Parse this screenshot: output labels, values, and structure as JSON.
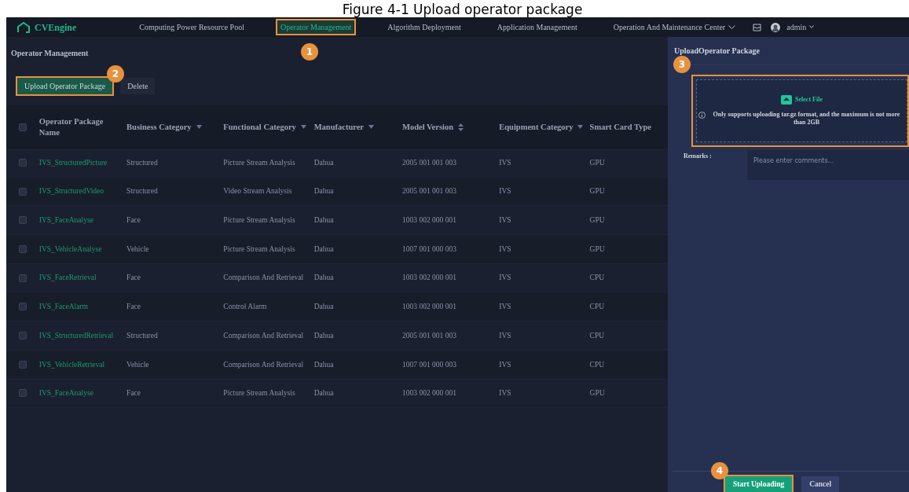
{
  "caption": "Figure 4-1 Upload operator package",
  "nav": {
    "brand": "CVEngine",
    "items": [
      {
        "label": "Computing Power Resource Pool",
        "selected": false,
        "highlighted": false,
        "dropdown": false
      },
      {
        "label": "Operator Management",
        "selected": true,
        "highlighted": true,
        "dropdown": false
      },
      {
        "label": "Algorithm Deployment",
        "selected": false,
        "highlighted": false,
        "dropdown": false
      },
      {
        "label": "Application Management",
        "selected": false,
        "highlighted": false,
        "dropdown": false
      },
      {
        "label": "Operation And Maintenance Center",
        "selected": false,
        "highlighted": false,
        "dropdown": true
      }
    ],
    "user": "admin"
  },
  "page_title": "Operator Management",
  "toolbar": [
    {
      "label": "Upload Operator Package",
      "kind": "primary",
      "highlighted": true
    },
    {
      "label": "Delete",
      "kind": "secondary",
      "highlighted": false
    }
  ],
  "table": {
    "header_checked": false,
    "columns": [
      {
        "label": "Operator Package Name",
        "kind": "plain"
      },
      {
        "label": "Business Category",
        "kind": "filter"
      },
      {
        "label": "Functional Category",
        "kind": "filter"
      },
      {
        "label": "Manufacturer",
        "kind": "filter"
      },
      {
        "label": "Model Version",
        "kind": "sort"
      },
      {
        "label": "Equipment Category",
        "kind": "filter"
      },
      {
        "label": "Smart Card Type",
        "kind": "plain"
      }
    ],
    "rows": [
      {
        "checked": false,
        "cells": [
          "IVS_StructuredPicture",
          "Structured",
          "Picture Stream Analysis",
          "Dahua",
          "2005 001 001 003",
          "IVS",
          "GPU"
        ]
      },
      {
        "checked": false,
        "cells": [
          "IVS_StructuredVideo",
          "Structured",
          "Video Stream Analysis",
          "Dahua",
          "2005 001 001 003",
          "IVS",
          "GPU"
        ]
      },
      {
        "checked": false,
        "cells": [
          "IVS_FaceAnalyse",
          "Face",
          "Picture Stream Analysis",
          "Dahua",
          "1003 002 000 001",
          "IVS",
          "GPU"
        ]
      },
      {
        "checked": false,
        "cells": [
          "IVS_VehicleAnalyse",
          "Vehicle",
          "Picture Stream Analysis",
          "Dahua",
          "1007 001 000 003",
          "IVS",
          "GPU"
        ]
      },
      {
        "checked": false,
        "cells": [
          "IVS_FaceRetrieval",
          "Face",
          "Comparison And Retrieval",
          "Dahua",
          "1003 002 000 001",
          "IVS",
          "CPU"
        ]
      },
      {
        "checked": false,
        "cells": [
          "IVS_FaceAlarm",
          "Face",
          "Control Alarm",
          "Dahua",
          "1003 002 000 001",
          "IVS",
          "CPU"
        ]
      },
      {
        "checked": false,
        "cells": [
          "IVS_StructuredRetrieval",
          "Structured",
          "Comparison And Retrieval",
          "Dahua",
          "2005 001 001 003",
          "IVS",
          "CPU"
        ]
      },
      {
        "checked": false,
        "cells": [
          "IVS_VehicleRetrieval",
          "Vehicle",
          "Comparison And Retrieval",
          "Dahua",
          "1007 001 000 003",
          "IVS",
          "CPU"
        ]
      },
      {
        "checked": false,
        "cells": [
          "IVS_FaceAnalyse",
          "Face",
          "Picture Stream Analysis",
          "Dahua",
          "1003 002 000 001",
          "IVS",
          "GPU"
        ]
      }
    ]
  },
  "panel": {
    "title": "UploadOperator Package",
    "select_file": "Select File",
    "hint": "Only supports uploading tar.gz format, and the maximum is not more than 2GB",
    "remarks_label": "Remarks :",
    "remarks_placeholder": "Please enter comments...",
    "buttons": [
      {
        "label": "Start Uploading",
        "kind": "primary",
        "highlighted": true
      },
      {
        "label": "Cancel",
        "kind": "secondary",
        "highlighted": false
      }
    ]
  },
  "callouts": [
    "1",
    "2",
    "3",
    "4"
  ]
}
